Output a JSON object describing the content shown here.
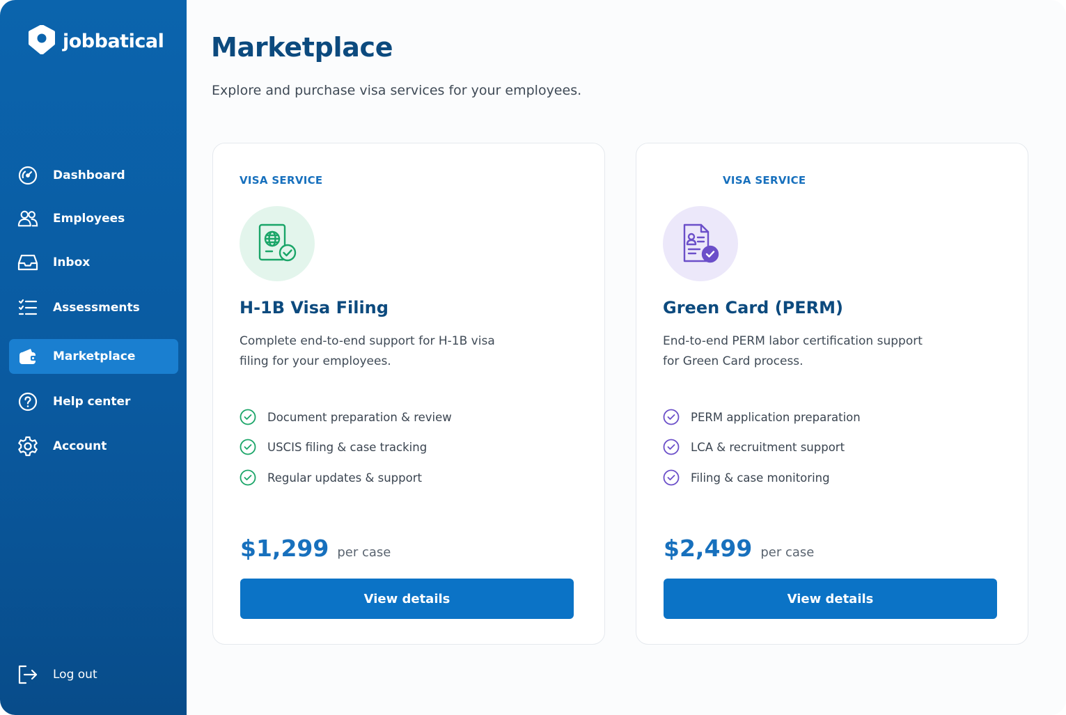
{
  "brand": {
    "name": "jobbatical"
  },
  "sidebar": {
    "items": [
      {
        "label": "Dashboard",
        "icon": "dashboard-icon"
      },
      {
        "label": "Employees",
        "icon": "users-icon"
      },
      {
        "label": "Inbox",
        "icon": "inbox-icon"
      },
      {
        "label": "Assessments",
        "icon": "checklist-icon"
      },
      {
        "label": "Marketplace",
        "icon": "wallet-icon",
        "active": true
      },
      {
        "label": "Help center",
        "icon": "help-icon"
      },
      {
        "label": "Account",
        "icon": "gear-icon"
      }
    ],
    "logout": {
      "label": "Log out",
      "icon": "logout-icon"
    }
  },
  "page": {
    "title": "Marketplace",
    "subtitle": "Explore and purchase visa services for your employees."
  },
  "cards": [
    {
      "eyebrow": "VISA SERVICE",
      "icon": "passport-globe-check-icon",
      "accent": "#1aa568",
      "badge_bg": "#e3f5ec",
      "title": "H-1B Visa Filing",
      "description": "Complete end-to-end support for H-1B visa filing for your employees.",
      "features": [
        "Document preparation & review",
        "USCIS filing & case tracking",
        "Regular updates & support"
      ],
      "price": "$1,299",
      "price_unit": "per case",
      "button": "View details"
    },
    {
      "eyebrow": "VISA SERVICE",
      "icon": "document-check-icon",
      "accent": "#6b4fc9",
      "badge_bg": "#ece8fa",
      "title": "Green Card (PERM)",
      "description": "End-to-end PERM labor certification support for Green Card process.",
      "features": [
        "PERM application preparation",
        "LCA & recruitment support",
        "Filing & case monitoring"
      ],
      "price": "$2,499",
      "price_unit": "per case",
      "button": "View details"
    }
  ],
  "colors": {
    "sidebar": "#0b64ad",
    "active_nav": "#1a7fd0",
    "primary_button": "#0b73c6",
    "title": "#0c4a7e"
  }
}
